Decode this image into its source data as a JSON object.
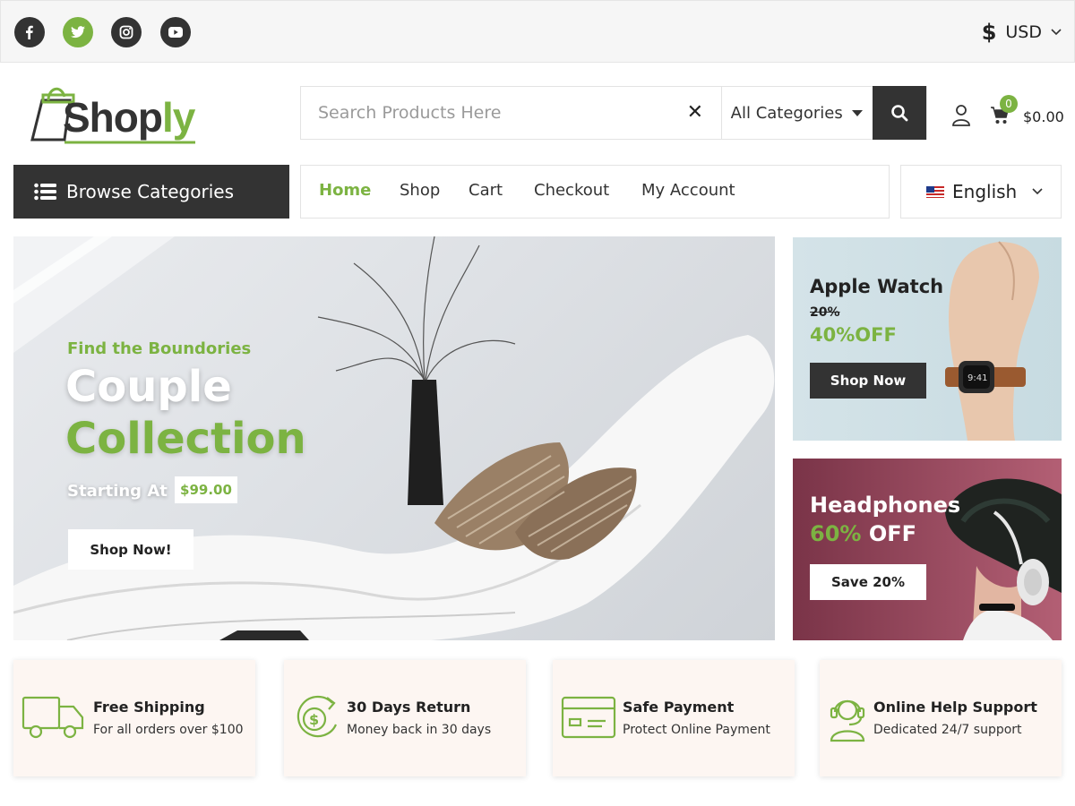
{
  "topbar": {
    "social": [
      "facebook-icon",
      "twitter-icon",
      "instagram-icon",
      "youtube-icon"
    ],
    "currency_symbol": "$",
    "currency": "USD"
  },
  "header": {
    "logo_main": "Shop",
    "logo_accent": "ly",
    "search_placeholder": "Search Products Here",
    "category_select": "All Categories",
    "cart_count": "0",
    "cart_total": "$0.00"
  },
  "nav": {
    "browse_label": "Browse Categories",
    "items": [
      "Home",
      "Shop",
      "Cart",
      "Checkout",
      "My Account"
    ],
    "language": "English"
  },
  "hero": {
    "eyebrow": "Find the Boundories",
    "title_line1": "Couple",
    "title_line2": "Collection",
    "starting_at": "Starting At",
    "price": "$99.00",
    "button": "Shop Now!"
  },
  "banners": [
    {
      "title": "Apple Watch",
      "old_discount": "20%",
      "discount": "40%OFF",
      "button": "Shop Now"
    },
    {
      "title": "Headphones",
      "discount_accent": "60%",
      "discount_text": "OFF",
      "button": "Save 20%"
    }
  ],
  "features": [
    {
      "title": "Free Shipping",
      "subtitle": "For all orders over $100"
    },
    {
      "title": "30 Days Return",
      "subtitle": "Money back in 30 days"
    },
    {
      "title": "Safe Payment",
      "subtitle": "Protect Online Payment"
    },
    {
      "title": "Online Help Support",
      "subtitle": "Dedicated 24/7 support"
    }
  ],
  "colors": {
    "accent": "#7cb342",
    "dark": "#333333",
    "feature_bg": "#fdf6f2"
  }
}
